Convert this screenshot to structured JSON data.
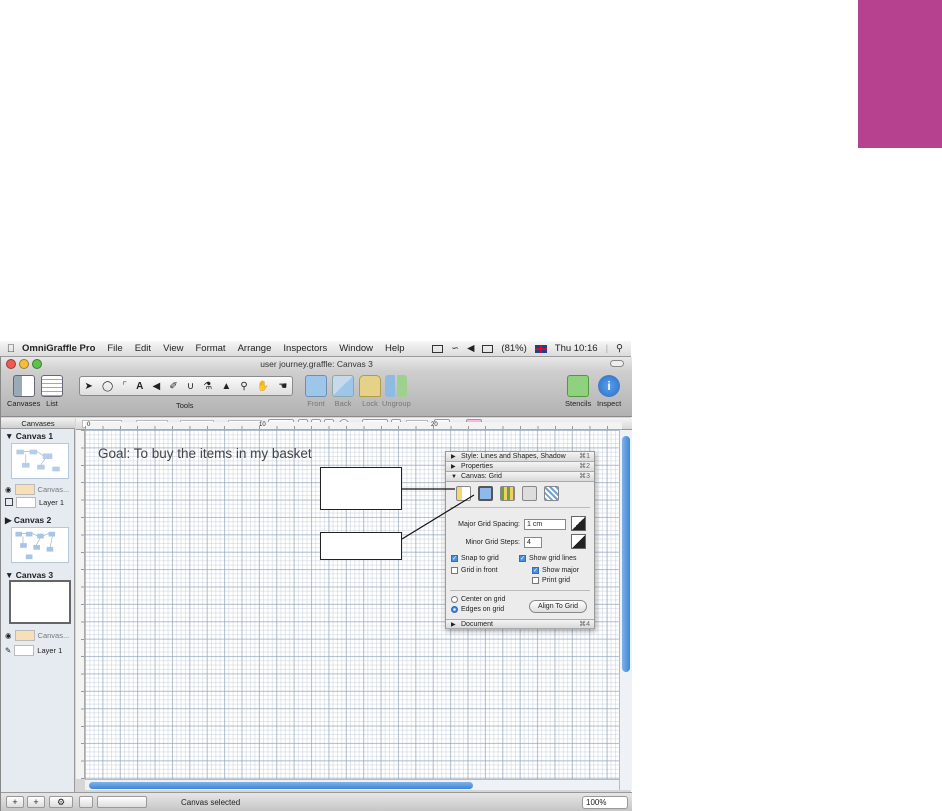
{
  "menubar": {
    "app_name": "OmniGraffle Pro",
    "items": [
      "File",
      "Edit",
      "View",
      "Format",
      "Arrange",
      "Inspectors",
      "Window",
      "Help"
    ],
    "battery": "(81%)",
    "clock": "Thu 10:16"
  },
  "window": {
    "title": "user journey.graffle: Canvas 3"
  },
  "toolbar": {
    "canvases_label": "Canvases",
    "list_label": "List",
    "tools_label": "Tools",
    "front_label": "Front",
    "back_label": "Back",
    "lock_label": "Lock",
    "ungroup_label": "Ungroup",
    "stencils_label": "Stencils",
    "inspect_label": "Inspect"
  },
  "sidebar": {
    "header": "Canvases",
    "canvases": [
      {
        "title": "Canvas 1",
        "layers": [
          "Canvas...",
          "Layer 1"
        ]
      },
      {
        "title": "Canvas 2",
        "layers": []
      },
      {
        "title": "Canvas 3",
        "layers": [
          "Canvas...",
          "Layer 1"
        ]
      }
    ]
  },
  "ruler": {
    "tick_a": "0",
    "tick_b": "10",
    "tick_c": "20"
  },
  "canvas": {
    "goal_text": "Goal: To buy the items in my basket"
  },
  "inspector": {
    "rows": [
      {
        "label": "Style: Lines and Shapes, Shadow",
        "shortcut": "⌘1"
      },
      {
        "label": "Properties",
        "shortcut": "⌘2"
      },
      {
        "label": "Canvas: Grid",
        "shortcut": "⌘3"
      }
    ],
    "major_grid_label": "Major Grid Spacing:",
    "major_grid_value": "1 cm",
    "minor_grid_label": "Minor Grid Steps:",
    "minor_grid_value": "4",
    "snap_to_grid": "Snap to grid",
    "show_grid_lines": "Show grid lines",
    "grid_in_front": "Grid in front",
    "show_major": "Show major",
    "print_grid": "Print grid",
    "center_on_grid": "Center on grid",
    "edges_on_grid": "Edges on grid",
    "align_to_grid": "Align To Grid",
    "document_label": "Document",
    "document_shortcut": "⌘4"
  },
  "status": {
    "text": "Canvas selected",
    "zoom": "100%"
  },
  "colors": {
    "accent_tab": "#b5418f",
    "scroll_thumb": "#3d87d6"
  }
}
